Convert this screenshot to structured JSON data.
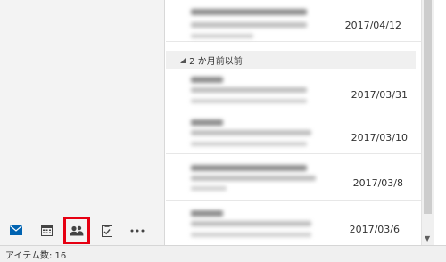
{
  "nav": {
    "items": [
      {
        "id": "mail",
        "icon": "mail-icon"
      },
      {
        "id": "calendar",
        "icon": "calendar-icon"
      },
      {
        "id": "people",
        "icon": "people-icon",
        "selected": true
      },
      {
        "id": "tasks",
        "icon": "tasks-icon"
      },
      {
        "id": "more",
        "icon": "more-icon"
      }
    ],
    "accent_color": "#0063b1",
    "highlight_color": "#e60012"
  },
  "message_list": {
    "group_label": "2 か月前以前",
    "items": [
      {
        "date": "2017/04/12"
      },
      {
        "date": "2017/03/31"
      },
      {
        "date": "2017/03/10"
      },
      {
        "date": "2017/03/8"
      },
      {
        "date": "2017/03/6"
      }
    ]
  },
  "status": {
    "item_count_label": "アイテム数: 16"
  }
}
